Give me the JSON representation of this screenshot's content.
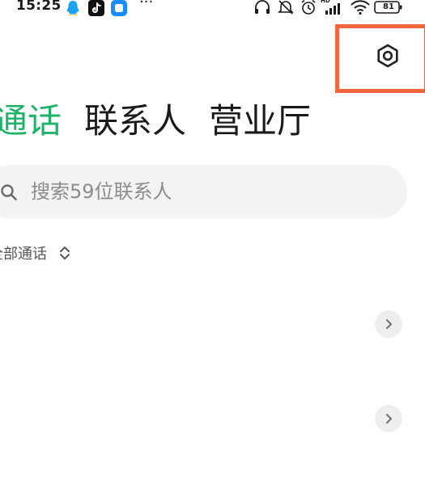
{
  "status_bar": {
    "time": "15:25",
    "more": "···",
    "hd": "HD",
    "battery": "81",
    "app_icons": [
      "qq-icon",
      "tiktok-icon",
      "message-icon"
    ],
    "system_icons": [
      "headphone-icon",
      "mute-bell-icon",
      "alarm-icon",
      "signal-icon",
      "wifi-icon",
      "battery-icon"
    ]
  },
  "header": {
    "settings_icon": "settings-icon",
    "highlight_color": "#f2653e"
  },
  "tabs": [
    {
      "label": "通话",
      "active": true
    },
    {
      "label": "联系人",
      "active": false
    },
    {
      "label": "营业厅",
      "active": false
    }
  ],
  "search": {
    "placeholder": "搜索59位联系人",
    "value": ""
  },
  "filter": {
    "label": "全部通话"
  },
  "colors": {
    "accent": "#1fb36a",
    "text": "#1a1a1a",
    "search_bg": "#f3f3f3"
  }
}
